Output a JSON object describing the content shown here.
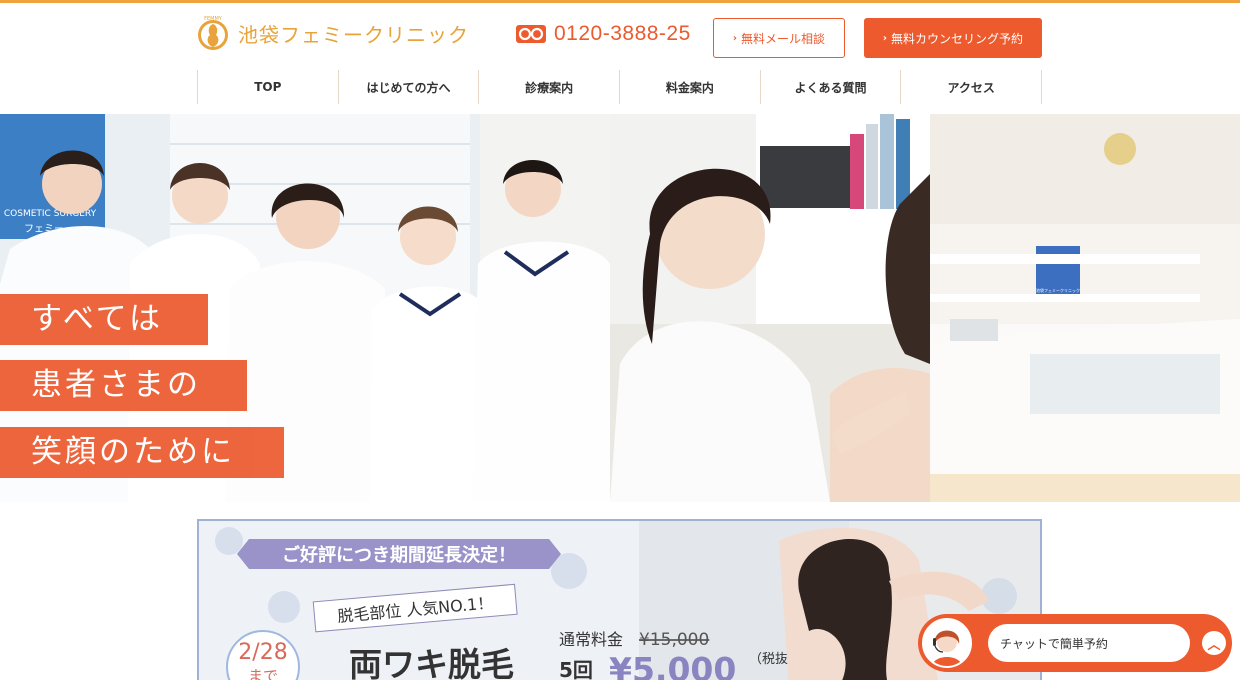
{
  "header": {
    "logo_text": "池袋フェミークリニック",
    "logo_emblem_text": "FEMMY",
    "phone_number": "0120-3888-25",
    "mail_button_label": "無料メール相談",
    "reserve_button_label": "無料カウンセリング予約"
  },
  "nav": {
    "items": [
      {
        "label": "TOP"
      },
      {
        "label": "はじめての方へ"
      },
      {
        "label": "診療案内"
      },
      {
        "label": "料金案内"
      },
      {
        "label": "よくある質問"
      },
      {
        "label": "アクセス"
      }
    ]
  },
  "hero": {
    "tagline_lines": [
      "すべては",
      "患者さまの",
      "笑顔のために"
    ],
    "wall_sign_text": "COSMETIC SURGERY",
    "wall_sign_text_2": "フェミー",
    "reception_sign_text": "池袋フェミークリニック"
  },
  "banner": {
    "ribbon": "ご好評につき期間延長決定！",
    "sub_heading": "脱毛部位 人気NO.1！",
    "deadline_date": "2/28",
    "deadline_suffix": "まで",
    "title": "両ワキ脱毛",
    "regular_price_label": "通常料金",
    "regular_price": "¥15,000",
    "count": "5回",
    "price": "¥5,000",
    "tax_note": "（税抜"
  },
  "chat": {
    "label": "チャットで簡単予約",
    "toggle_icon": "chevron-up-icon"
  },
  "colors": {
    "accent": "#ec5a2e",
    "logo": "#e8a43a",
    "top_line": "#f0a33c"
  }
}
